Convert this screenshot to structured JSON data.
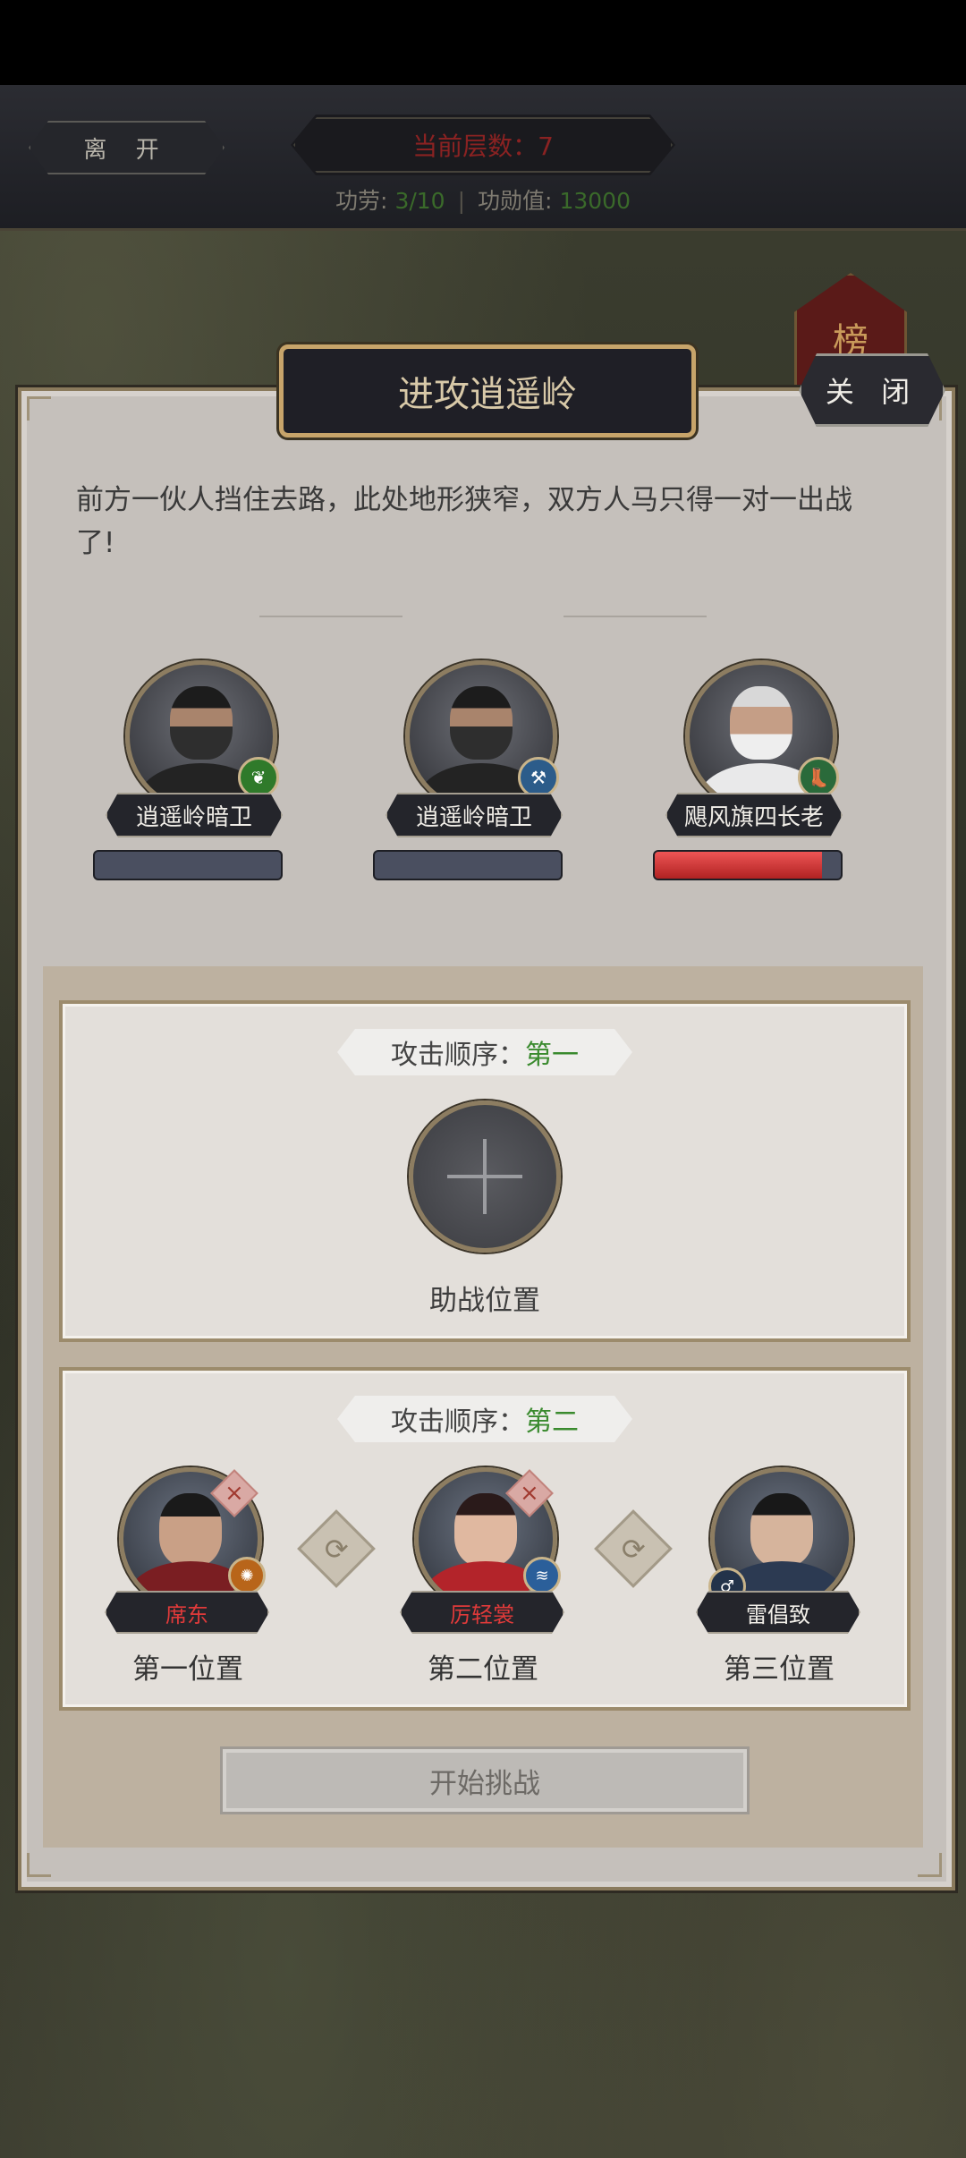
{
  "hud": {
    "leave_label": "离 开",
    "floor_label": "当前层数：7",
    "merit_label": "功劳:",
    "merit_value": "3/10",
    "merit_points_label": "功勋值:",
    "merit_points_value": "13000"
  },
  "rank_banner": "榜",
  "dialog": {
    "title": "进攻逍遥岭",
    "close_label": "关 闭",
    "description": "前方一伙人挡住去路，此处地形狭窄，双方人马只得一对一出战了!"
  },
  "enemies": [
    {
      "name": "逍遥岭暗卫",
      "class_icon": "leaf-icon",
      "hp_fraction": 0
    },
    {
      "name": "逍遥岭暗卫",
      "class_icon": "hammer-icon",
      "hp_fraction": 0
    },
    {
      "name": "飓风旗四长老",
      "class_icon": "boot-icon",
      "hp_fraction": 0.9
    }
  ],
  "panel1": {
    "order_prefix": "攻击顺序：",
    "order_value": "第一",
    "slot_caption": "助战位置"
  },
  "panel2": {
    "order_prefix": "攻击顺序：",
    "order_value": "第二"
  },
  "heroes": [
    {
      "name": "席东",
      "position_label": "第一位置",
      "name_color": "#e03a3a",
      "class_icon": "fire-icon",
      "removable": true
    },
    {
      "name": "厉轻裳",
      "position_label": "第二位置",
      "name_color": "#e03a3a",
      "class_icon": "wave-icon",
      "removable": true
    },
    {
      "name": "雷倡致",
      "position_label": "第三位置",
      "name_color": "#f1eee8",
      "class_icon": "male-icon",
      "removable": false
    }
  ],
  "start_label": "开始挑战",
  "colors": {
    "accent_green": "#3a8a2e",
    "hp_red": "#d23030",
    "gold_border": "#c7a46a"
  }
}
